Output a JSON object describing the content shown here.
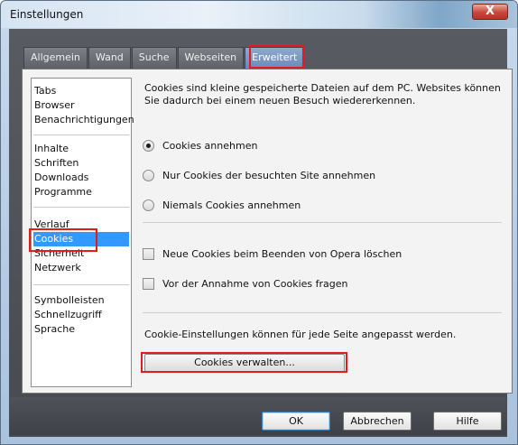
{
  "window": {
    "title": "Einstellungen",
    "close_label": "X"
  },
  "tabs": [
    {
      "label": "Allgemein",
      "active": false
    },
    {
      "label": "Wand",
      "active": false
    },
    {
      "label": "Suche",
      "active": false
    },
    {
      "label": "Webseiten",
      "active": false
    },
    {
      "label": "Erweitert",
      "active": true
    }
  ],
  "sidebar": {
    "groups": [
      [
        "Tabs",
        "Browser",
        "Benachrichtigungen"
      ],
      [
        "Inhalte",
        "Schriften",
        "Downloads",
        "Programme"
      ],
      [
        "Verlauf",
        "Cookies",
        "Sicherheit",
        "Netzwerk"
      ],
      [
        "Symbolleisten",
        "Schnellzugriff",
        "Sprache"
      ]
    ],
    "selected": "Cookies"
  },
  "content": {
    "description": "Cookies sind kleine gespeicherte Dateien auf dem PC. Websites können Sie dadurch bei einem neuen Besuch wiedererkennen.",
    "radios": [
      {
        "label": "Cookies annehmen",
        "checked": true
      },
      {
        "label": "Nur Cookies der besuchten Site annehmen",
        "checked": false
      },
      {
        "label": "Niemals Cookies annehmen",
        "checked": false
      }
    ],
    "checkboxes": [
      {
        "label": "Neue Cookies beim Beenden von Opera löschen",
        "checked": false
      },
      {
        "label": "Vor der Annahme von Cookies fragen",
        "checked": false
      }
    ],
    "info": "Cookie-Einstellungen können für jede Seite angepasst werden.",
    "manage_button": "Cookies verwalten..."
  },
  "footer": {
    "ok": "OK",
    "cancel": "Abbrechen",
    "help": "Hilfe"
  },
  "colors": {
    "highlight": "#e21c1c",
    "selection": "#3399ff"
  }
}
